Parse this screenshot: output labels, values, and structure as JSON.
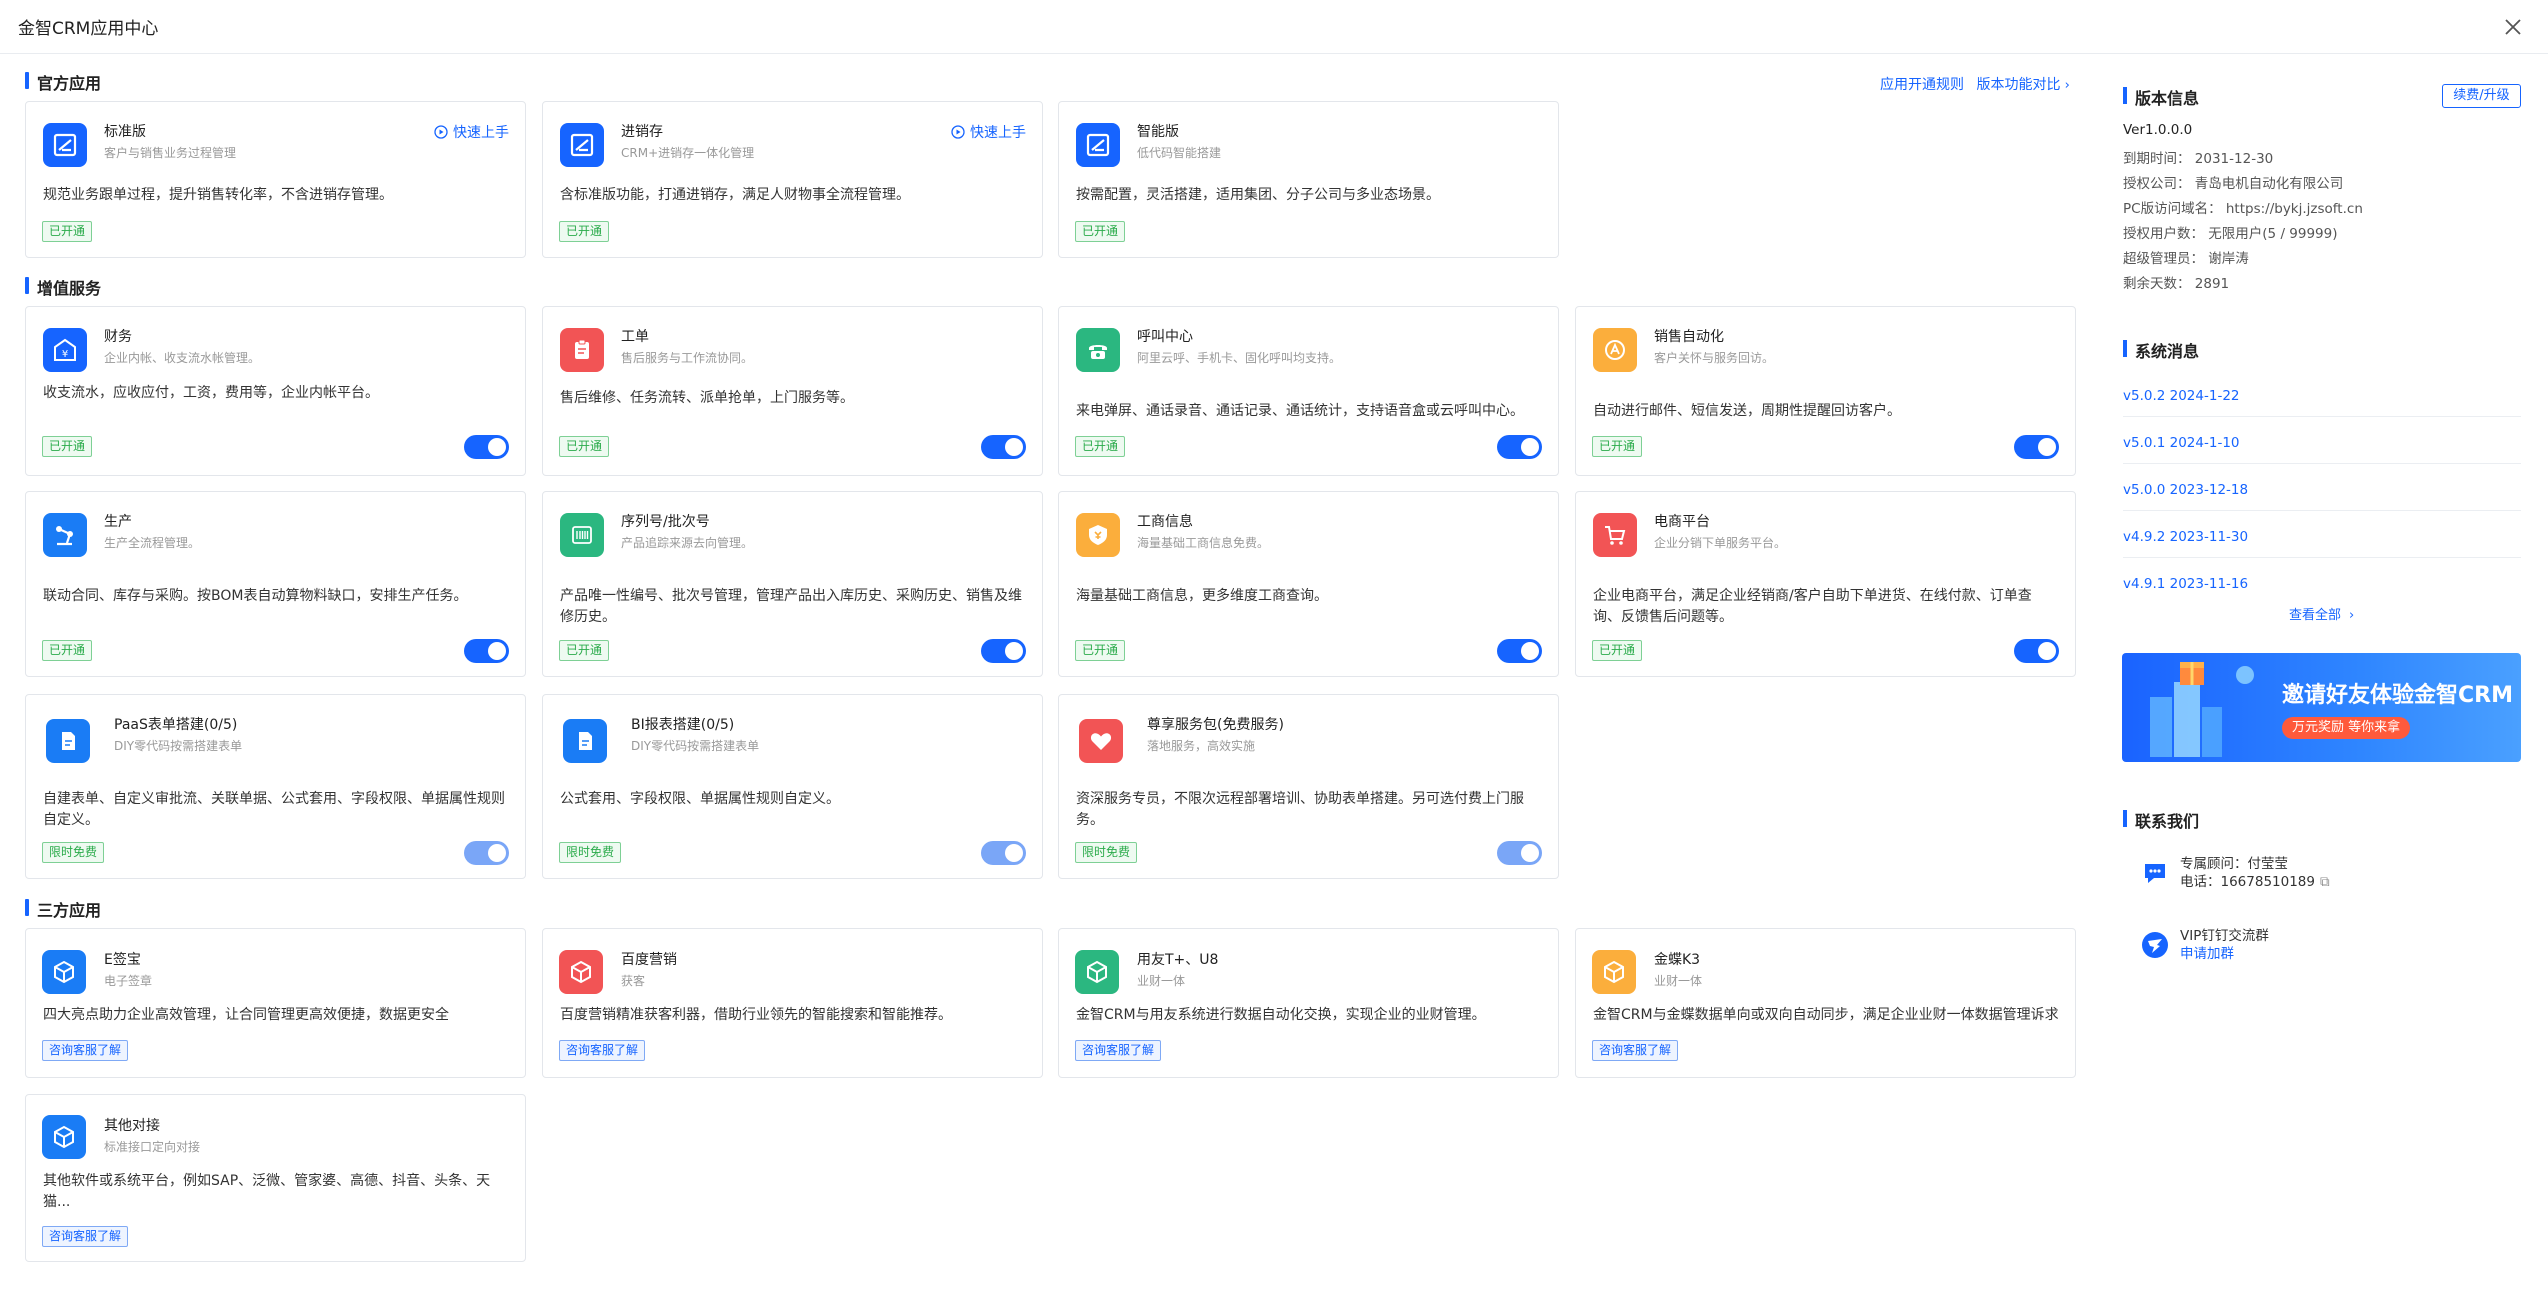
{
  "window": {
    "title": "金智CRM应用中心"
  },
  "sections": {
    "official": "官方应用",
    "value_added": "增值服务",
    "third_party": "三方应用"
  },
  "top_links": {
    "rules": "应用开通规则",
    "compare": "版本功能对比"
  },
  "official_apps": [
    {
      "title": "标准版",
      "subtitle": "客户与销售业务过程管理",
      "desc": "规范业务跟单过程，提升销售转化率，不含进销存管理。",
      "tag": "已开通",
      "quick_start": "快速上手"
    },
    {
      "title": "进销存",
      "subtitle": "CRM+进销存一体化管理",
      "desc": "含标准版功能，打通进销存，满足人财物事全流程管理。",
      "tag": "已开通",
      "quick_start": "快速上手"
    },
    {
      "title": "智能版",
      "subtitle": "低代码智能搭建",
      "desc": "按需配置，灵活搭建，适用集团、分子公司与多业态场景。",
      "tag": "已开通"
    }
  ],
  "value_services": [
    {
      "title": "财务",
      "subtitle": "企业内帐、收支流水帐管理。",
      "desc": "收支流水，应收应付，工资，费用等，企业内帐平台。",
      "tag": "已开通",
      "icon": "finance-icon",
      "color": "#1664ff"
    },
    {
      "title": "工单",
      "subtitle": "售后服务与工作流协同。",
      "desc": "售后维修、任务流转、派单抢单，上门服务等。",
      "tag": "已开通",
      "icon": "clipboard-icon",
      "color": "#f25455"
    },
    {
      "title": "呼叫中心",
      "subtitle": "阿里云呼、手机卡、固化呼叫均支持。",
      "desc": "来电弹屏、通话录音、通话记录、通话统计，支持语音盒或云呼叫中心。",
      "tag": "已开通",
      "icon": "phone-icon",
      "color": "#2bb780"
    },
    {
      "title": "销售自动化",
      "subtitle": "客户关怀与服务回访。",
      "desc": "自动进行邮件、短信发送，周期性提醒回访客户。",
      "tag": "已开通",
      "icon": "automation-icon",
      "color": "#fbae3c"
    },
    {
      "title": "生产",
      "subtitle": "生产全流程管理。",
      "desc": "联动合同、库存与采购。按BOM表自动算物料缺口，安排生产任务。",
      "tag": "已开通",
      "icon": "robot-arm-icon",
      "color": "#1a7cf5"
    },
    {
      "title": "序列号/批次号",
      "subtitle": "产品追踪来源去向管理。",
      "desc": "产品唯一性编号、批次号管理，管理产品出入库历史、采购历史、销售及维修历史。",
      "tag": "已开通",
      "icon": "barcode-icon",
      "color": "#2bb780"
    },
    {
      "title": "工商信息",
      "subtitle": "海量基础工商信息免费。",
      "desc": "海量基础工商信息，更多维度工商查询。",
      "tag": "已开通",
      "icon": "business-info-icon",
      "color": "#fbae3c"
    },
    {
      "title": "电商平台",
      "subtitle": "企业分销下单服务平台。",
      "desc": "企业电商平台，满足企业经销商/客户自助下单进货、在线付款、订单查询、反馈售后问题等。",
      "tag": "已开通",
      "icon": "cart-icon",
      "color": "#f25455"
    },
    {
      "title": "PaaS表单搭建(0/5)",
      "subtitle": "DIY零代码按需搭建表单",
      "desc": "自建表单、自定义审批流、关联单据、公式套用、字段权限、单据属性规则自定义。",
      "tag": "限时免费",
      "icon": "form-icon",
      "color": "#1a7cf5"
    },
    {
      "title": "BI报表搭建(0/5)",
      "subtitle": "DIY零代码按需搭建表单",
      "desc": "公式套用、字段权限、单据属性规则自定义。",
      "tag": "限时免费",
      "icon": "report-icon",
      "color": "#1a7cf5"
    },
    {
      "title": "尊享服务包(免费服务)",
      "subtitle": "落地服务，高效实施",
      "desc": "资深服务专员，不限次远程部署培训、协助表单搭建。另可选付费上门服务。",
      "tag": "限时免费",
      "icon": "heart-icon",
      "color": "#f25455"
    }
  ],
  "third_apps": [
    {
      "title": "E签宝",
      "subtitle": "电子签章",
      "desc": "四大亮点助力企业高效管理，让合同管理更高效便捷，数据更安全",
      "tag": "咨询客服了解",
      "color": "#1a7cf5"
    },
    {
      "title": "百度营销",
      "subtitle": "获客",
      "desc": "百度营销精准获客利器，借助行业领先的智能搜索和智能推荐。",
      "tag": "咨询客服了解",
      "color": "#f25455"
    },
    {
      "title": "用友T+、U8",
      "subtitle": "业财一体",
      "desc": "金智CRM与用友系统进行数据自动化交换，实现企业的业财管理。",
      "tag": "咨询客服了解",
      "color": "#2bb780"
    },
    {
      "title": "金蝶K3",
      "subtitle": "业财一体",
      "desc": "金智CRM与金蝶数据单向或双向自动同步，满足企业业财一体数据管理诉求",
      "tag": "咨询客服了解",
      "color": "#fbae3c"
    },
    {
      "title": "其他对接",
      "subtitle": "标准接口定向对接",
      "desc": "其他软件或系统平台，例如SAP、泛微、管家婆、高德、抖音、头条、天猫...",
      "tag": "咨询客服了解",
      "color": "#1a7cf5"
    }
  ],
  "sidebar": {
    "version_title": "版本信息",
    "renew_label": "续费/升级",
    "version": "Ver1.0.0.0",
    "expire": "到期时间：  2031-12-30",
    "company": "授权公司：  青岛电机自动化有限公司",
    "domain": "PC版访问域名：  https://bykj.jzsoft.cn",
    "users": "授权用户数：  无限用户(5 / 99999)",
    "admin": "超级管理员：  谢岸涛",
    "days_left": "剩余天数：  2891",
    "messages_title": "系统消息",
    "messages": [
      "v5.0.2 2024-1-22",
      "v5.0.1 2024-1-10",
      "v5.0.0 2023-12-18",
      "v4.9.2 2023-11-30",
      "v4.9.1 2023-11-16"
    ],
    "view_all": "查看全部",
    "banner_title": "邀请好友体验金智CRM",
    "banner_pill": "万元奖励  等你来拿",
    "contact_title": "联系我们",
    "consultant": "专属顾问：付莹莹",
    "phone": "电话：16678510189",
    "vip_group": "VIP钉钉交流群",
    "apply_join": "申请加群"
  }
}
